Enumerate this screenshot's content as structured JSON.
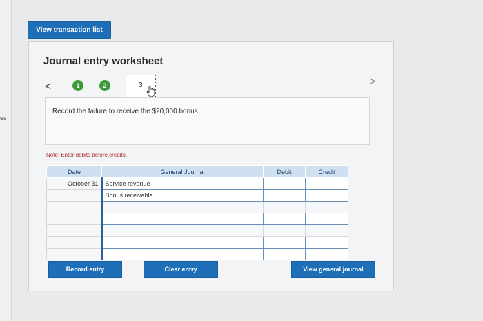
{
  "left_strip": {
    "cut_text": "es"
  },
  "top_button": {
    "label": "View transaction list"
  },
  "worksheet": {
    "title": "Journal entry worksheet",
    "nav": {
      "prev": "<",
      "next": ">"
    },
    "steps": [
      {
        "label": "1",
        "state": "complete"
      },
      {
        "label": "2",
        "state": "complete"
      },
      {
        "label": "3",
        "state": "current"
      }
    ],
    "instruction": "Record the failure to receive the $20,000 bonus.",
    "note": "Note: Enter debits before credits.",
    "table": {
      "headers": {
        "date": "Date",
        "journal": "General Journal",
        "debit": "Debit",
        "credit": "Credit"
      },
      "rows": [
        {
          "date": "October 31",
          "account": "Service revenue",
          "debit": "",
          "credit": ""
        },
        {
          "date": "",
          "account": "Bonus receivable",
          "debit": "",
          "credit": ""
        },
        {
          "date": "",
          "account": "",
          "debit": "",
          "credit": ""
        },
        {
          "date": "",
          "account": "",
          "debit": "",
          "credit": ""
        },
        {
          "date": "",
          "account": "",
          "debit": "",
          "credit": ""
        },
        {
          "date": "",
          "account": "",
          "debit": "",
          "credit": ""
        },
        {
          "date": "",
          "account": "",
          "debit": "",
          "credit": ""
        }
      ]
    },
    "buttons": {
      "record": "Record entry",
      "clear": "Clear entry",
      "view_journal": "View general journal"
    }
  },
  "colors": {
    "accent": "#1f6fb8",
    "step_complete": "#3c9a3c",
    "header_bg": "#cfe0f1",
    "note_text": "#b03030"
  }
}
